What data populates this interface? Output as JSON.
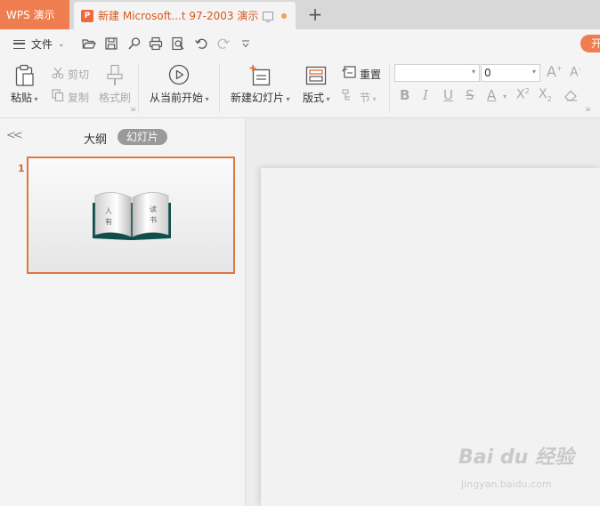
{
  "app_tab": {
    "label": "WPS 演示"
  },
  "doc_tab": {
    "badge": "P",
    "title": "新建 Microsoft...t 97-2003 演示"
  },
  "new_tab_label": "+",
  "quick": {
    "menu_label": "文件",
    "open_label": "开"
  },
  "ribbon": {
    "paste": "粘贴",
    "cut": "剪切",
    "copy": "复制",
    "format_painter": "格式刷",
    "play_from_current": "从当前开始",
    "new_slide": "新建幻灯片",
    "layout": "版式",
    "reset": "重置",
    "section": "节",
    "font_size_value": "0"
  },
  "left_pane": {
    "collapse_glyph": "<<",
    "tab_outline": "大纲",
    "tab_slides": "幻灯片",
    "slides": [
      {
        "number": "1",
        "thumbnail_art_text": [
          "人",
          "有",
          "读",
          "书"
        ]
      }
    ]
  },
  "watermark": {
    "main": "Bai du 经验",
    "sub": "jingyan.baidu.com"
  },
  "colors": {
    "accent": "#ee7d4f",
    "tab_text": "#d9581e",
    "thumb_border": "#e0763f"
  }
}
